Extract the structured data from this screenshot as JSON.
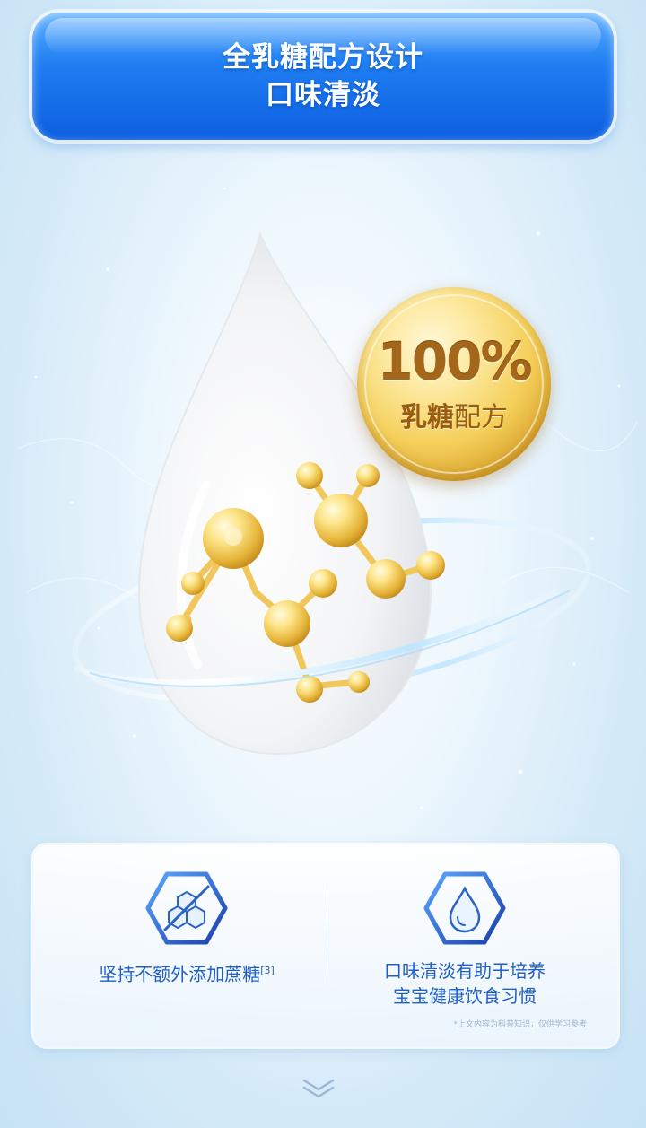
{
  "header": {
    "line1": "全乳糖配方设计",
    "line2": "口味清淡"
  },
  "badge": {
    "percent": "100%",
    "label_bold": "乳糖",
    "label_normal": "配方"
  },
  "features": [
    {
      "icon": "sugar-cubes-icon",
      "text": "坚持不额外添加蔗糖",
      "ref": "[3]"
    },
    {
      "icon": "water-drop-icon",
      "text_line1": "口味清淡有助于培养",
      "text_line2": "宝宝健康饮食习惯"
    }
  ],
  "footnote": "*上文内容为科普知识，仅供学习参考",
  "colors": {
    "banner_blue": "#1f7ef2",
    "gold": "#f4cf5a",
    "feature_text_blue": "#1f5fc4"
  }
}
